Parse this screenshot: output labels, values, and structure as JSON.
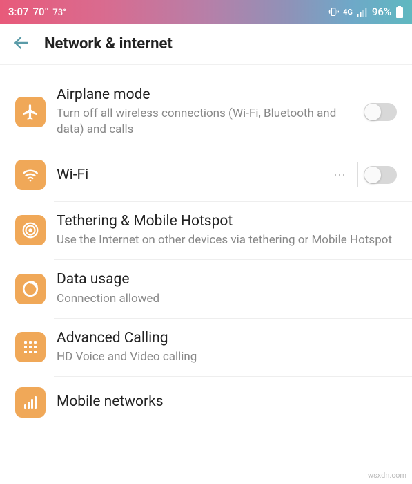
{
  "status_bar": {
    "time": "3:07",
    "temp1": "70°",
    "temp2": "73°",
    "network_label": "4G",
    "battery_pct": "96%"
  },
  "header": {
    "title": "Network & internet"
  },
  "items": [
    {
      "title": "Airplane mode",
      "subtitle": "Turn off all wireless connections (Wi-Fi, Bluetooth and data) and calls"
    },
    {
      "title": "Wi-Fi",
      "subtitle": ""
    },
    {
      "title": "Tethering & Mobile Hotspot",
      "subtitle": "Use the Internet on other devices via tethering or Mobile Hotspot"
    },
    {
      "title": "Data usage",
      "subtitle": "Connection allowed"
    },
    {
      "title": "Advanced Calling",
      "subtitle": "HD Voice and Video calling"
    },
    {
      "title": "Mobile networks",
      "subtitle": ""
    }
  ],
  "watermark": "wsxdn.com"
}
